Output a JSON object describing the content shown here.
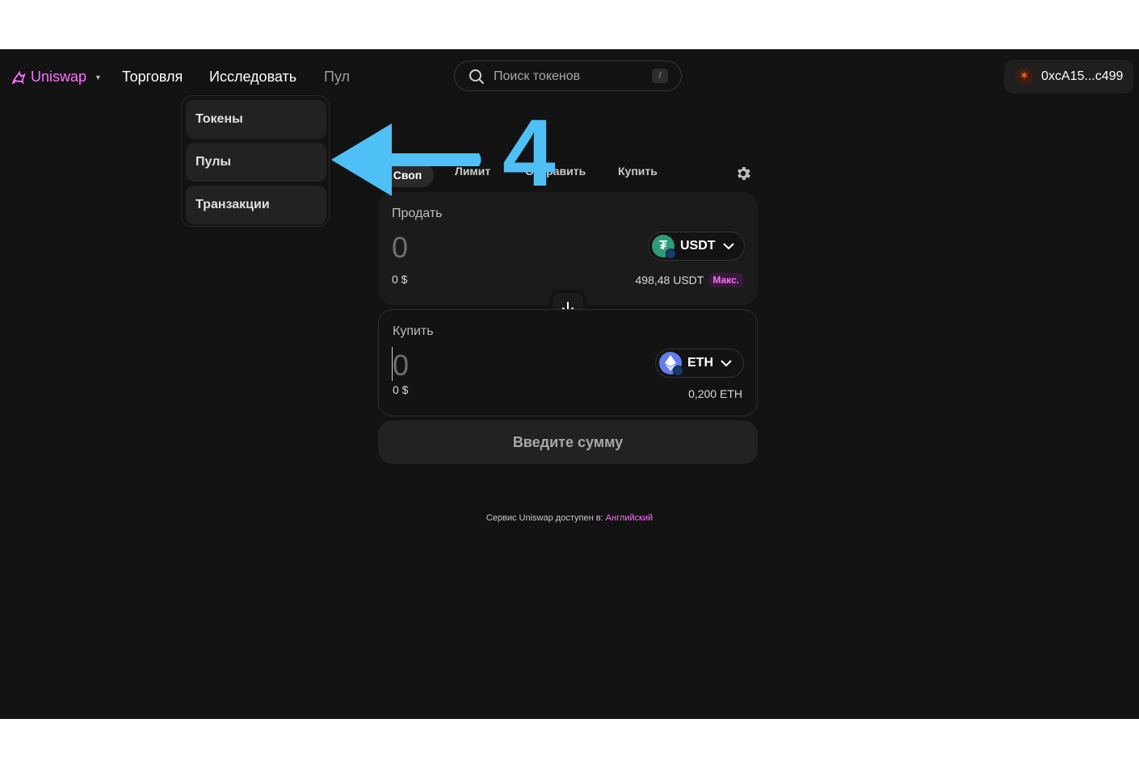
{
  "brand": {
    "name": "Uniswap",
    "accent": "#fc72ff"
  },
  "nav": {
    "trade": "Торговля",
    "explore": "Исследовать",
    "pool": "Пул"
  },
  "search": {
    "placeholder": "Поиск токенов",
    "shortcut": "/"
  },
  "account": {
    "address": "0xcA15...c499"
  },
  "explore_menu": {
    "items": [
      "Токены",
      "Пулы",
      "Транзакции"
    ]
  },
  "tabs": {
    "swap": "Своп",
    "limit": "Лимит",
    "send": "Отправить",
    "buy": "Купить"
  },
  "sell": {
    "label": "Продать",
    "amount": "0",
    "usd": "0 $",
    "token": "USDT",
    "balance": "498,48 USDT",
    "max": "Макс."
  },
  "buy": {
    "label": "Купить",
    "amount": "0",
    "usd": "0 $",
    "token": "ETH",
    "balance": "0,200 ETH"
  },
  "cta": "Введите сумму",
  "footer": {
    "prefix": "Сервис Uniswap доступен в:",
    "language": "Английский"
  },
  "annotation": {
    "step_number": "4",
    "color": "#4ec0f5"
  },
  "icons": [
    "uniswap-logo-icon",
    "search-icon",
    "account-avatar-icon",
    "settings-gear-icon",
    "usdt-token-icon",
    "eth-token-icon",
    "chevron-down-icon",
    "arrow-down-icon"
  ]
}
